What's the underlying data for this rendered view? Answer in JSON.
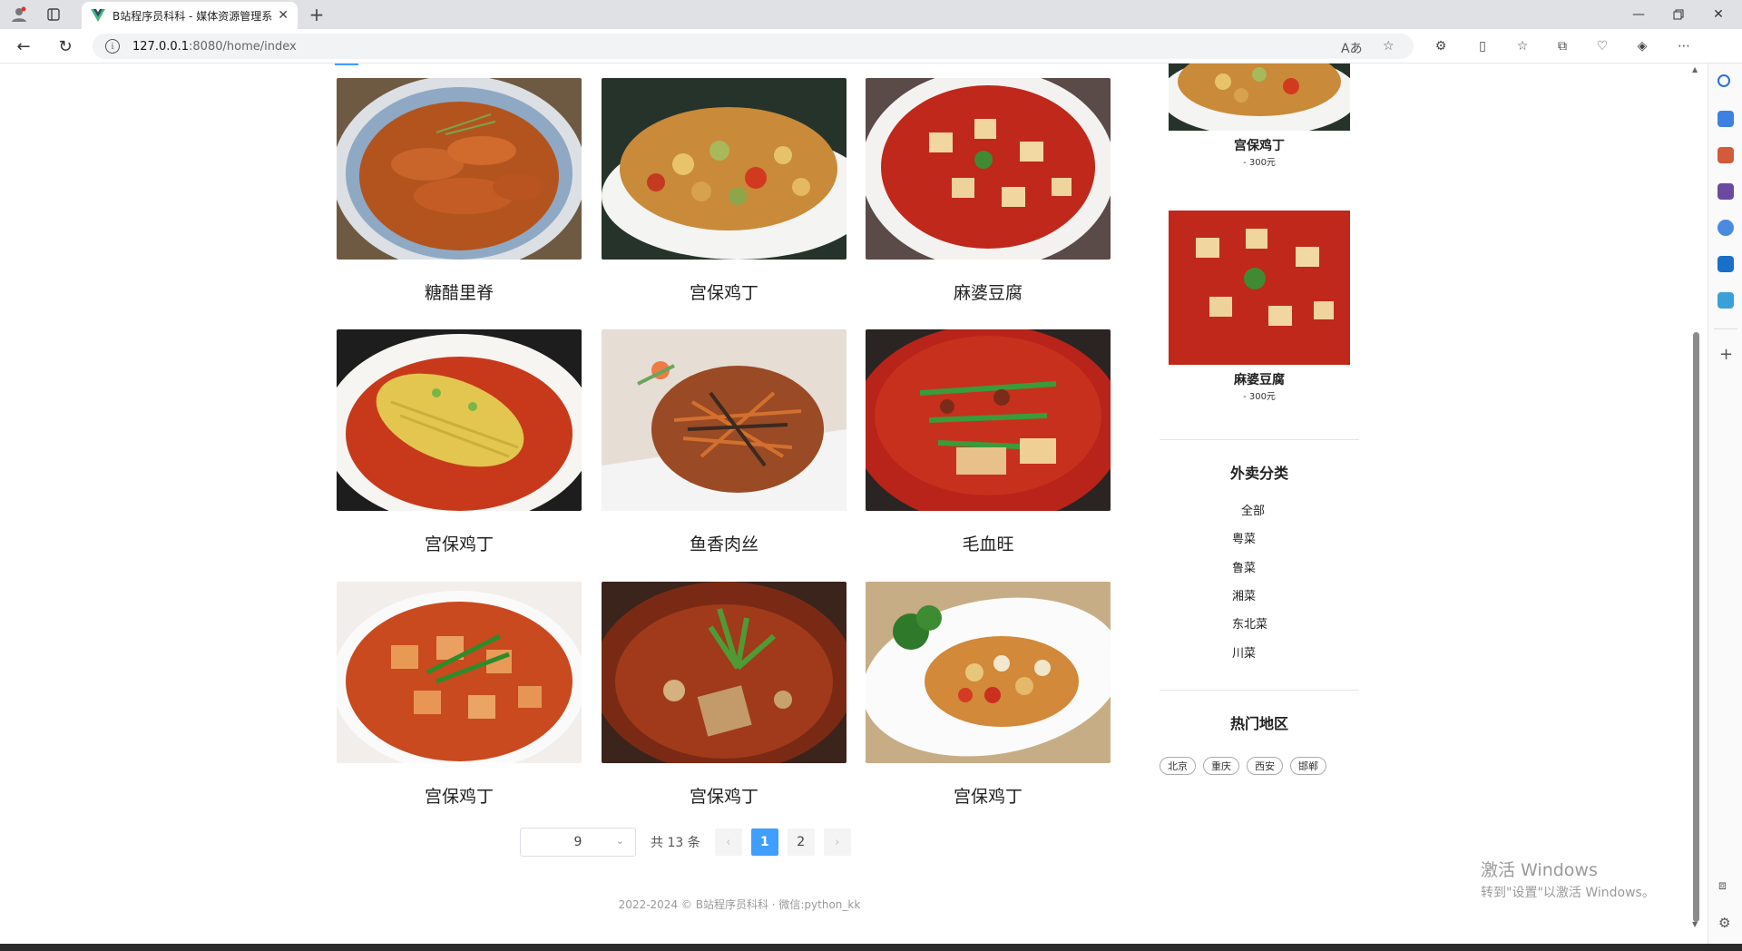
{
  "browser": {
    "tab_title": "B站程序员科科 - 媒体资源管理系",
    "url_host": "127.0.0.1",
    "url_path": ":8080/home/index"
  },
  "dishes": [
    {
      "name": "糖醋里脊",
      "image": "sweet-sour-pork"
    },
    {
      "name": "宫保鸡丁",
      "image": "kungpao-chicken"
    },
    {
      "name": "麻婆豆腐",
      "image": "mapo-tofu"
    },
    {
      "name": "宫保鸡丁",
      "image": "chicken-chili-oil"
    },
    {
      "name": "鱼香肉丝",
      "image": "fish-flavored-pork"
    },
    {
      "name": "毛血旺",
      "image": "maoxuewang"
    },
    {
      "name": "宫保鸡丁",
      "image": "mapo-tofu-green"
    },
    {
      "name": "宫保鸡丁",
      "image": "spicy-pot"
    },
    {
      "name": "宫保鸡丁",
      "image": "kungpao-plate"
    }
  ],
  "pagination": {
    "page_size": "9",
    "total": "共 13 条",
    "pages": [
      "1",
      "2"
    ],
    "current": "1"
  },
  "sidebar": {
    "featured": [
      {
        "name": "宫保鸡丁",
        "price": "- 300元"
      },
      {
        "name": "麻婆豆腐",
        "price": "- 300元"
      }
    ],
    "category_title": "外卖分类",
    "categories": [
      "全部",
      "粤菜",
      "鲁菜",
      "湘菜",
      "东北菜",
      "川菜"
    ],
    "region_title": "热门地区",
    "regions": [
      "北京",
      "重庆",
      "西安",
      "邯郸"
    ]
  },
  "footer": "2022-2024 © B站程序员科科 · 微信:python_kk",
  "watermark": {
    "line1": "激活 Windows",
    "line2": "转到\"设置\"以激活 Windows。"
  },
  "colors": {
    "accent": "#409eff"
  }
}
